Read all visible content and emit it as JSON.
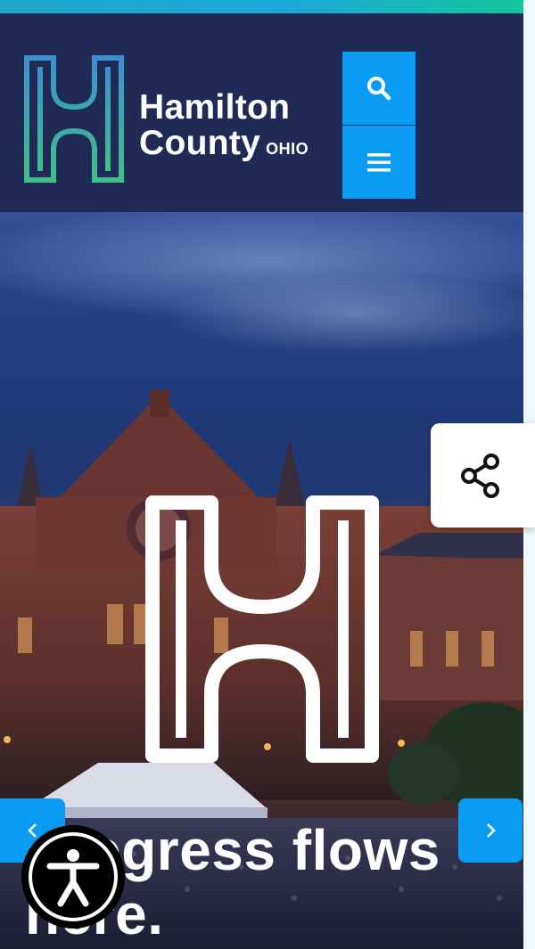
{
  "header": {
    "logo_line1": "Hamilton",
    "logo_line2": "County",
    "logo_state": "OHIO",
    "logo_icon": "hamilton-h-logo",
    "search_icon": "search-icon",
    "menu_icon": "hamburger-menu-icon"
  },
  "hero": {
    "headline_line1": "Progress flows",
    "headline_line2": "here.",
    "prev_icon": "chevron-left-icon",
    "next_icon": "chevron-right-icon"
  },
  "share": {
    "icon": "share-icon"
  },
  "accessibility": {
    "icon": "accessibility-person-icon"
  },
  "colors": {
    "header_bg": "#1f2a55",
    "accent_blue": "#0a9cf2",
    "logo_gradient_top": "#3e8fd0",
    "logo_gradient_bottom": "#3fc08a"
  }
}
